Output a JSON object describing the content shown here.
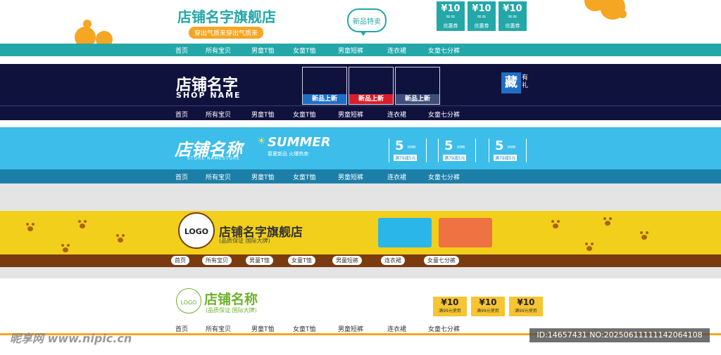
{
  "colors": {
    "teal": "#23a7a8",
    "navy": "#10123e",
    "sky": "#3cbdea",
    "yellow": "#f2cf1a",
    "brown": "#7a3b10",
    "green": "#6db12c",
    "orange": "#f5a623",
    "coupon_yellow": "#f7c531"
  },
  "nav": [
    "首页",
    "所有宝贝",
    "男童T恤",
    "女童T恤",
    "男童短裤",
    "连衣裙",
    "女童七分裤"
  ],
  "banner1": {
    "title": "店铺名字旗舰店",
    "slogan": "穿出气质来穿出气质来",
    "bubble": "新品特卖",
    "coupons": [
      {
        "value": "¥10",
        "label": "优惠券"
      },
      {
        "value": "¥10",
        "label": "优惠券"
      },
      {
        "value": "¥10",
        "label": "优惠券"
      }
    ]
  },
  "banner2": {
    "title": "店铺名字",
    "subtitle": "SHOP NAME",
    "products": [
      {
        "label": "新品上新",
        "color": "#1f6fc7"
      },
      {
        "label": "新品上新",
        "color": "#d81e2a"
      },
      {
        "label": "新品上新",
        "color": "#3f4f7a"
      }
    ],
    "favorite_big": "藏",
    "favorite_small": "有礼"
  },
  "banner3": {
    "title": "店铺名称",
    "subtitle": "STORE NAMESTORE",
    "summer": "SUMMER",
    "summer_sub": "春夏新品 火爆热卖",
    "coupons": [
      {
        "value": "5",
        "unit": "RMB",
        "cond": "满79减5元"
      },
      {
        "value": "5",
        "unit": "RMB",
        "cond": "满79减5元"
      },
      {
        "value": "5",
        "unit": "RMB",
        "cond": "满79减5元"
      }
    ]
  },
  "banner4": {
    "logo": "LOGO",
    "title": "店铺名字旗舰店",
    "sub": "(品质保证 国际大牌)",
    "boxes": [
      "#2ab6e8",
      "#ee7242"
    ]
  },
  "banner5": {
    "logo": "LOGO",
    "title": "店铺名称",
    "sub": "(品质保证 国际大牌)",
    "coupons": [
      {
        "value": "¥10",
        "cond": "满99元使用"
      },
      {
        "value": "¥10",
        "cond": "满99元使用"
      },
      {
        "value": "¥10",
        "cond": "满99元使用"
      }
    ]
  },
  "watermark": {
    "site": "昵享网 www.nipic.cn",
    "id": "ID:14657431 NO:20250611111142064108"
  }
}
